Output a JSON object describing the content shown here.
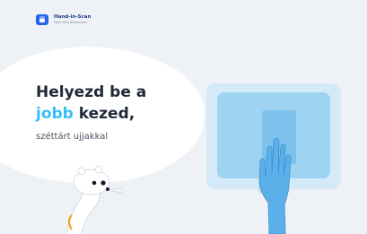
{
  "brand": {
    "name": "Hand-in-Scan",
    "tagline": "Palm Vein Biometrics",
    "mark_icon": "palm-logo-icon",
    "color": "#2563eb"
  },
  "prompt": {
    "line1": "Helyezd be a",
    "accent_word": "jobb",
    "line2_rest": " kezed,",
    "subtitle": "széttárt ujjakkal"
  },
  "colors": {
    "background": "#eef1f5",
    "accent": "#38bdf8",
    "text_dark": "#1f2937",
    "scanner": "#9fd3f2",
    "hand": "#5bb0ea"
  },
  "illustrations": {
    "mascot_icon": "ferret-mascot-icon",
    "device_icon": "palm-scanner-icon",
    "hand_icon": "right-hand-icon"
  }
}
